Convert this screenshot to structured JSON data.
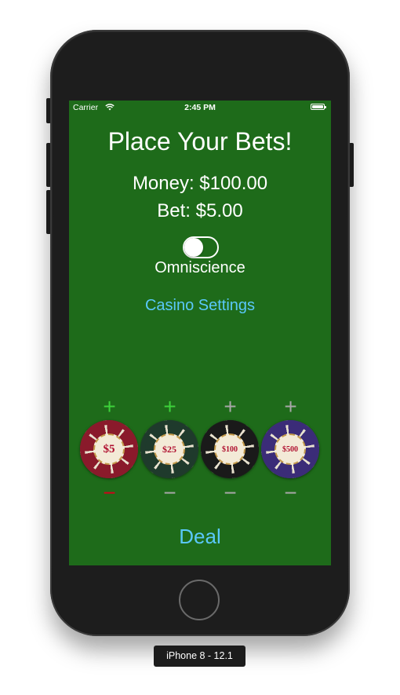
{
  "status_bar": {
    "carrier": "Carrier",
    "time": "2:45 PM",
    "wifi_icon": "wifi-icon",
    "battery_icon": "battery-full-icon"
  },
  "title": "Place Your Bets!",
  "money_text": "Money: $100.00",
  "bet_text": "Bet: $5.00",
  "omniscience": {
    "label": "Omniscience",
    "on": false
  },
  "settings_link": "Casino Settings",
  "chips": [
    {
      "value": "$5",
      "plus": "+",
      "minus": "−",
      "plus_color": "#3dd23a",
      "minus_color": "#d0021b",
      "chip_color": "#8a1a2b",
      "text_color": "#b01030"
    },
    {
      "value": "$25",
      "plus": "+",
      "minus": "−",
      "plus_color": "#3dd23a",
      "minus_color": "#a7a7a7",
      "chip_color": "#1f3a2c",
      "text_color": "#b01030"
    },
    {
      "value": "$100",
      "plus": "+",
      "minus": "−",
      "plus_color": "#a7a7a7",
      "minus_color": "#a7a7a7",
      "chip_color": "#1a1a1a",
      "text_color": "#b01030"
    },
    {
      "value": "$500",
      "plus": "+",
      "minus": "−",
      "plus_color": "#a7a7a7",
      "minus_color": "#a7a7a7",
      "chip_color": "#3b2c78",
      "text_color": "#b01030"
    }
  ],
  "deal_label": "Deal",
  "device_label": "iPhone 8 - 12.1",
  "colors": {
    "table_green": "#1e6b1a",
    "link_blue": "#5ac8fa"
  }
}
